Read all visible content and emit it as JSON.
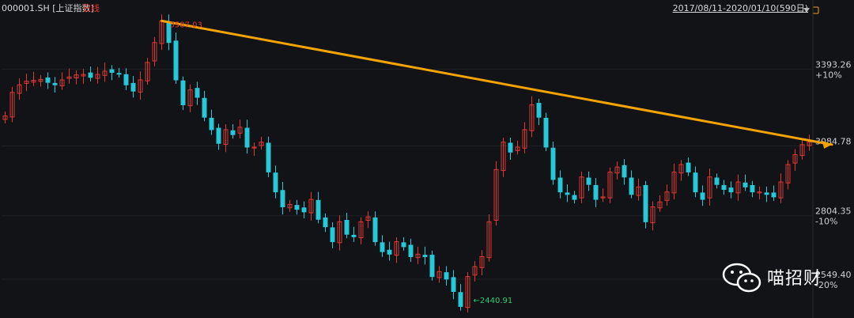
{
  "header": {
    "symbol": "000001.SH",
    "index_name": "[上证指数]",
    "period": "日线",
    "date_range": "2017/08/11-2020/01/10(590日)"
  },
  "watermark": {
    "text": "喵招财"
  },
  "colors": {
    "up": "#e0382f",
    "down": "#27c8d8",
    "trendline": "#f5a300",
    "max_label": "#e0382f",
    "min_label": "#2ecc71",
    "background": "#121317"
  },
  "chart_data": {
    "type": "candlestick",
    "date_range": [
      "2017-08-11",
      "2020-01-10"
    ],
    "trading_days": 590,
    "y_axis": {
      "ylim": [
        2400,
        3620
      ],
      "ticks": [
        {
          "value": 3393.26,
          "label": "3393.26",
          "pct": "+10%"
        },
        {
          "value": 3084.78,
          "label": "3084.78",
          "pct": ""
        },
        {
          "value": 2804.35,
          "label": "2804.35",
          "pct": "-10%"
        },
        {
          "value": 2549.4,
          "label": "2549.40",
          "pct": "-20%"
        }
      ]
    },
    "annotations": {
      "max": {
        "value": 3587.03,
        "label": "3587.03",
        "index": 22
      },
      "min": {
        "value": 2440.91,
        "label": "2440.91",
        "index": 64
      }
    },
    "trendline": {
      "from": {
        "index": 22,
        "value": 3587.03
      },
      "to": {
        "index": 120,
        "value": 3090
      }
    },
    "closes": [
      3205,
      3300,
      3330,
      3345,
      3348,
      3352,
      3340,
      3330,
      3350,
      3362,
      3370,
      3372,
      3360,
      3372,
      3385,
      3380,
      3375,
      3330,
      3305,
      3350,
      3420,
      3500,
      3587,
      3500,
      3350,
      3250,
      3310,
      3280,
      3200,
      3150,
      3095,
      3150,
      3130,
      3160,
      3080,
      3080,
      3100,
      2980,
      2900,
      2840,
      2850,
      2830,
      2820,
      2870,
      2790,
      2760,
      2700,
      2780,
      2730,
      2720,
      2780,
      2800,
      2700,
      2660,
      2650,
      2700,
      2680,
      2640,
      2650,
      2640,
      2560,
      2580,
      2550,
      2500,
      2440,
      2560,
      2600,
      2640,
      2780,
      2990,
      3100,
      3060,
      3080,
      3150,
      3250,
      3200,
      3080,
      2950,
      2900,
      2890,
      2870,
      2960,
      2930,
      2870,
      2880,
      2980,
      3000,
      2960,
      2890,
      2920,
      2780,
      2840,
      2860,
      2900,
      2980,
      3010,
      2980,
      2900,
      2870,
      2960,
      2930,
      2910,
      2900,
      2940,
      2920,
      2900,
      2900,
      2890,
      2880,
      2940,
      3010,
      3050,
      3090,
      3100
    ]
  }
}
